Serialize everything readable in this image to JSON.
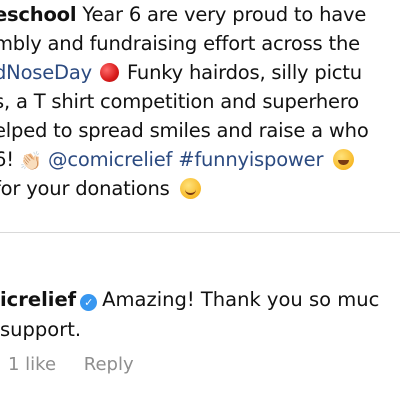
{
  "post": {
    "caption_lines": [
      {
        "user": "eschool",
        "text": " Year 6 are very proud to have"
      },
      {
        "text": "mbly and fundraising effort across the"
      },
      {
        "tag": "dNoseDay",
        "text": " Funky hairdos, silly pictu"
      },
      {
        "text": "s, a T shirt competition and superhero"
      },
      {
        "text": "elped to spread smiles and raise a who"
      },
      {
        "prefix": "6! ",
        "mention": "@comicrelief",
        "hashtag": "#funnyispower"
      },
      {
        "text": "for your donations"
      }
    ]
  },
  "comment": {
    "username": "icrelief",
    "text_line1": "Amazing! Thank you so muc",
    "text_line2": " support.",
    "likes": "1 like",
    "reply_label": "Reply"
  },
  "icons": {
    "red_circle": "red-circle-emoji",
    "clap": "clapping-hands-emoji",
    "laugh": "rolling-laughing-emoji",
    "smile": "smiling-face-emoji",
    "verified": "verified-badge-icon"
  },
  "colors": {
    "hashtag": "#2b4a80",
    "meta": "#8e8e8e",
    "verified": "#3897f0"
  }
}
